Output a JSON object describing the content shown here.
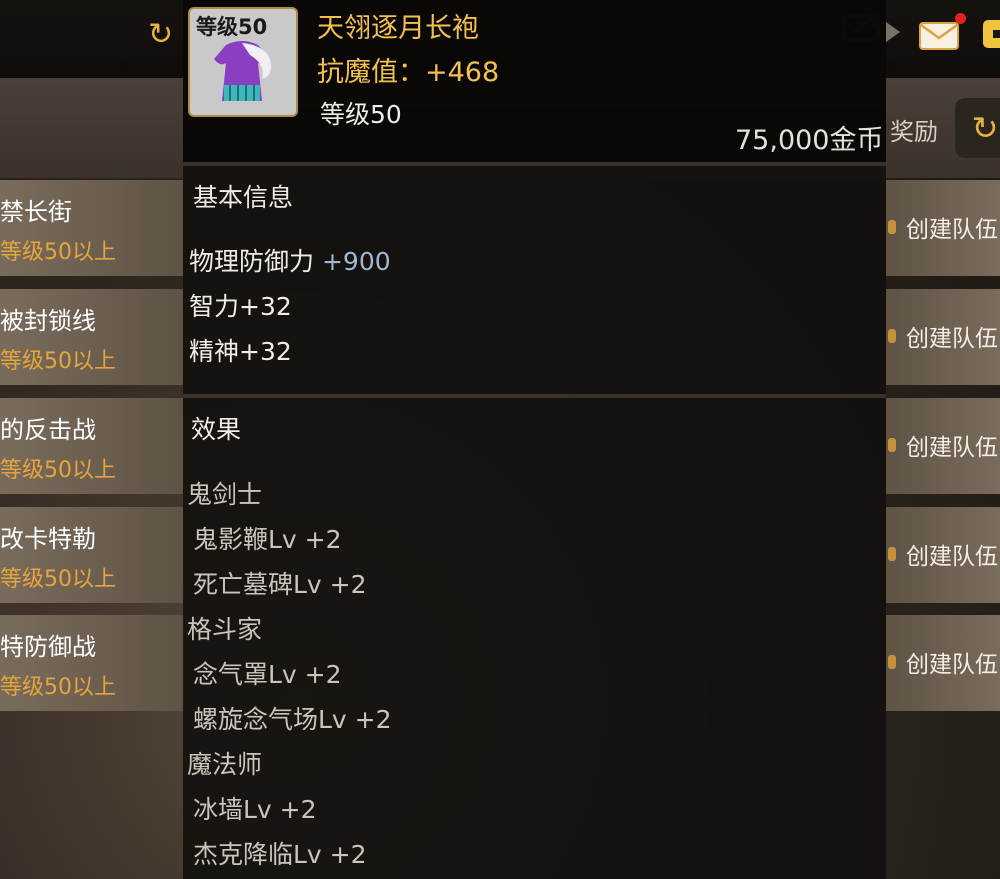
{
  "top_bar": {
    "refresh_icon": "refresh-icon",
    "share_icon": "share-icon",
    "mail_icon": "mail-icon",
    "more_icon": "menu-icon",
    "reward_text": "奖励",
    "accent_color": "#f2c14e"
  },
  "dungeons": [
    {
      "name": "禁长街",
      "req": "等级50以上",
      "action": "创建队伍"
    },
    {
      "name": "被封锁线",
      "req": "等级50以上",
      "action": "创建队伍"
    },
    {
      "name": "的反击战",
      "req": "等级50以上",
      "action": "创建队伍"
    },
    {
      "name": "改卡特勒",
      "req": "等级50以上",
      "action": "创建队伍"
    },
    {
      "name": "特防御战",
      "req": "等级50以上",
      "action": "创建队伍"
    }
  ],
  "tooltip": {
    "icon_level": "等级50",
    "item_name": "天翎逐月长袍",
    "resist_label": "抗魔值：",
    "resist_value": "+468",
    "level": "等级50",
    "price": "75,000金币",
    "basic_info_title": "基本信息",
    "stats": [
      {
        "label": "物理防御力",
        "value": "+900"
      },
      {
        "label": "智力+32",
        "value": ""
      },
      {
        "label": "精神+32",
        "value": ""
      }
    ],
    "effects_title": "效果",
    "effects": [
      {
        "class": "鬼剑士",
        "skills": [
          "鬼影鞭Lv +2",
          "死亡墓碑Lv +2"
        ]
      },
      {
        "class": "格斗家",
        "skills": [
          "念气罩Lv +2",
          "螺旋念气场Lv +2"
        ]
      },
      {
        "class": "魔法师",
        "skills": [
          "冰墙Lv +2",
          "杰克降临Lv +2"
        ]
      }
    ]
  }
}
